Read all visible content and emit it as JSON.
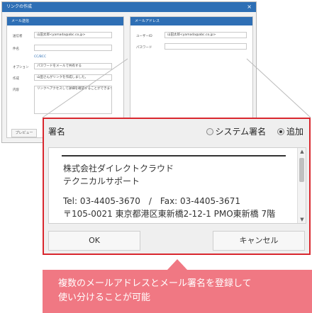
{
  "background_window": {
    "title": "リンクの作成",
    "close": "×",
    "left_panel": {
      "title": "メール送信",
      "fields": [
        {
          "label": "送信者",
          "value": "山田太郎<yamada@abc.co.jp>"
        },
        {
          "label": "件名",
          "value": ""
        },
        {
          "label": "オプション",
          "value": "パスワードをメールで共有する"
        },
        {
          "label": "作成",
          "value": "山田さんがリンクを作成しました。"
        },
        {
          "label": "内容",
          "value": "リンクへアクセスして詳細を確認することができます。"
        }
      ],
      "cc_link": "CC/BCC",
      "preview_button": "プレビュー"
    },
    "right_panel": {
      "title": "メールアドレス",
      "fields": [
        {
          "label": "ユーザーID",
          "value": "山田太郎<yamada@abc.co.jp>"
        },
        {
          "label": "パスワード",
          "value": ""
        }
      ]
    }
  },
  "dialog": {
    "signature_label": "署名",
    "radio_system": "システム署名",
    "radio_add": "追加",
    "selected_radio": "追加",
    "signature_lines": [
      "株式会社ダイレクトクラウド",
      "テクニカルサポート",
      "Tel: 03-4405-3670　/　Fax: 03-4405-3671",
      "〒105-0021 東京都港区東新橋2-12-1 PMO東新橋 7階"
    ],
    "ok_button": "OK",
    "cancel_button": "キャンセル"
  },
  "callout": {
    "line1": "複数のメールアドレスとメール署名を登録して",
    "line2": "使い分けることが可能"
  },
  "colors": {
    "accent_blue": "#2e6fb5",
    "highlight_red": "#d9272e",
    "callout_pink": "#f07883"
  }
}
